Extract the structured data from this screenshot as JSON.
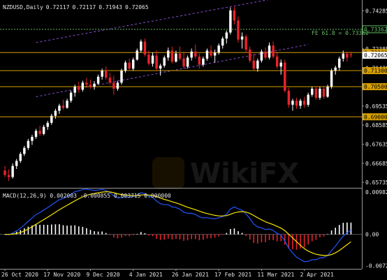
{
  "chart_data": [
    {
      "type": "candlestick",
      "title": "NZDUSD,Daily",
      "ohlc_readout": [
        "0.72117",
        "0.72117",
        "0.71943",
        "0.72065"
      ],
      "colors": {
        "bull": "#ffffff",
        "bear": "#e8232b",
        "background": "#000000",
        "level": "#d8a000",
        "fib": "#66c066",
        "channel": "#8a4fd6"
      },
      "y_axis": {
        "ticks": [
          0.74285,
          0.73335,
          0.72385,
          0.7143,
          0.7048,
          0.69535,
          0.68585,
          0.67635,
          0.66685,
          0.65735
        ],
        "ylim": [
          0.6553,
          0.7468
        ]
      },
      "x_axis": {
        "ticks": [
          "26 Oct 2020",
          "17 Nov 2020",
          "9 Dec 2020",
          "4 Jan 2021",
          "26 Jan 2021",
          "17 Feb 2021",
          "11 Mar 2021",
          "2 Apr 2021"
        ]
      },
      "candles": [
        [
          0.6632,
          0.6655,
          0.66,
          0.661
        ],
        [
          0.661,
          0.6638,
          0.658,
          0.66
        ],
        [
          0.66,
          0.6668,
          0.6592,
          0.6655
        ],
        [
          0.6655,
          0.669,
          0.664,
          0.668
        ],
        [
          0.668,
          0.6725,
          0.667,
          0.6715
        ],
        [
          0.6715,
          0.6755,
          0.6705,
          0.6745
        ],
        [
          0.6745,
          0.679,
          0.6735,
          0.678
        ],
        [
          0.678,
          0.681,
          0.676,
          0.68
        ],
        [
          0.68,
          0.684,
          0.679,
          0.683
        ],
        [
          0.683,
          0.6855,
          0.6805,
          0.6815
        ],
        [
          0.6815,
          0.686,
          0.6808,
          0.685
        ],
        [
          0.685,
          0.688,
          0.6835,
          0.687
        ],
        [
          0.687,
          0.6915,
          0.686,
          0.6905
        ],
        [
          0.6905,
          0.694,
          0.689,
          0.693
        ],
        [
          0.693,
          0.6965,
          0.6915,
          0.6955
        ],
        [
          0.6955,
          0.6985,
          0.6935,
          0.6945
        ],
        [
          0.6945,
          0.699,
          0.694,
          0.698
        ],
        [
          0.698,
          0.703,
          0.697,
          0.702
        ],
        [
          0.702,
          0.706,
          0.7,
          0.705
        ],
        [
          0.705,
          0.7075,
          0.702,
          0.7035
        ],
        [
          0.7035,
          0.708,
          0.7025,
          0.707
        ],
        [
          0.707,
          0.7095,
          0.705,
          0.706
        ],
        [
          0.706,
          0.7085,
          0.704,
          0.705
        ],
        [
          0.705,
          0.7078,
          0.7035,
          0.7065
        ],
        [
          0.7065,
          0.711,
          0.706,
          0.71
        ],
        [
          0.71,
          0.714,
          0.7085,
          0.713
        ],
        [
          0.713,
          0.715,
          0.7085,
          0.7095
        ],
        [
          0.7095,
          0.712,
          0.706,
          0.707
        ],
        [
          0.707,
          0.7105,
          0.701,
          0.704
        ],
        [
          0.704,
          0.708,
          0.703,
          0.707
        ],
        [
          0.707,
          0.714,
          0.706,
          0.713
        ],
        [
          0.713,
          0.718,
          0.712,
          0.717
        ],
        [
          0.717,
          0.719,
          0.713,
          0.714
        ],
        [
          0.714,
          0.7195,
          0.713,
          0.7185
        ],
        [
          0.7185,
          0.724,
          0.718,
          0.723
        ],
        [
          0.723,
          0.7285,
          0.722,
          0.7275
        ],
        [
          0.7275,
          0.729,
          0.72,
          0.721
        ],
        [
          0.721,
          0.723,
          0.7155,
          0.7165
        ],
        [
          0.7165,
          0.722,
          0.715,
          0.7205
        ],
        [
          0.7205,
          0.723,
          0.713,
          0.714
        ],
        [
          0.714,
          0.7165,
          0.7105,
          0.7155
        ],
        [
          0.7155,
          0.7205,
          0.7145,
          0.7195
        ],
        [
          0.7195,
          0.7245,
          0.718,
          0.723
        ],
        [
          0.723,
          0.725,
          0.7165,
          0.7175
        ],
        [
          0.7175,
          0.723,
          0.717,
          0.7215
        ],
        [
          0.7215,
          0.725,
          0.718,
          0.719
        ],
        [
          0.719,
          0.7225,
          0.714,
          0.715
        ],
        [
          0.715,
          0.7205,
          0.714,
          0.7195
        ],
        [
          0.7195,
          0.724,
          0.718,
          0.7225
        ],
        [
          0.7225,
          0.726,
          0.719,
          0.72
        ],
        [
          0.72,
          0.7215,
          0.714,
          0.716
        ],
        [
          0.716,
          0.72,
          0.715,
          0.719
        ],
        [
          0.719,
          0.724,
          0.718,
          0.723
        ],
        [
          0.723,
          0.7255,
          0.7195,
          0.7205
        ],
        [
          0.7205,
          0.7235,
          0.717,
          0.722
        ],
        [
          0.722,
          0.7265,
          0.721,
          0.7255
        ],
        [
          0.7255,
          0.73,
          0.724,
          0.729
        ],
        [
          0.729,
          0.733,
          0.7265,
          0.732
        ],
        [
          0.732,
          0.7445,
          0.731,
          0.743
        ],
        [
          0.743,
          0.7448,
          0.736,
          0.738
        ],
        [
          0.738,
          0.74,
          0.727,
          0.7285
        ],
        [
          0.7285,
          0.732,
          0.724,
          0.73
        ],
        [
          0.73,
          0.731,
          0.722,
          0.7235
        ],
        [
          0.7235,
          0.725,
          0.717,
          0.718
        ],
        [
          0.718,
          0.7215,
          0.713,
          0.714
        ],
        [
          0.714,
          0.719,
          0.7125,
          0.718
        ],
        [
          0.718,
          0.7235,
          0.717,
          0.7225
        ],
        [
          0.7225,
          0.7245,
          0.7185,
          0.7195
        ],
        [
          0.7195,
          0.727,
          0.7185,
          0.7255
        ],
        [
          0.7255,
          0.7275,
          0.719,
          0.72
        ],
        [
          0.72,
          0.7225,
          0.714,
          0.715
        ],
        [
          0.715,
          0.7185,
          0.711,
          0.717
        ],
        [
          0.717,
          0.7185,
          0.702,
          0.703
        ],
        [
          0.703,
          0.7045,
          0.6945,
          0.696
        ],
        [
          0.696,
          0.699,
          0.693,
          0.698
        ],
        [
          0.698,
          0.6995,
          0.694,
          0.6955
        ],
        [
          0.6955,
          0.699,
          0.694,
          0.698
        ],
        [
          0.698,
          0.7,
          0.6945,
          0.696
        ],
        [
          0.696,
          0.702,
          0.695,
          0.701
        ],
        [
          0.701,
          0.705,
          0.7,
          0.704
        ],
        [
          0.704,
          0.7055,
          0.6985,
          0.6995
        ],
        [
          0.6995,
          0.705,
          0.6985,
          0.704
        ],
        [
          0.704,
          0.7055,
          0.699,
          0.7
        ],
        [
          0.7,
          0.706,
          0.6995,
          0.705
        ],
        [
          0.705,
          0.714,
          0.704,
          0.713
        ],
        [
          0.713,
          0.7155,
          0.711,
          0.7145
        ],
        [
          0.7145,
          0.72,
          0.713,
          0.719
        ],
        [
          0.719,
          0.723,
          0.7175,
          0.7215
        ],
        [
          0.7215,
          0.7225,
          0.7175,
          0.7195
        ],
        [
          0.7212,
          0.7225,
          0.7194,
          0.7207
        ]
      ],
      "levels": [
        {
          "price": 0.722,
          "label": "0.72200",
          "label_color": "#d8a000",
          "label_text_color": "#000000"
        },
        {
          "price": 0.713,
          "label": "0.71300",
          "label_color": "#d8a000",
          "label_text_color": "#000000"
        },
        {
          "price": 0.705,
          "label": "0.70500",
          "label_color": "#d8a000",
          "label_text_color": "#000000"
        },
        {
          "price": 0.69,
          "label": "0.69000",
          "label_color": "#d8a000",
          "label_text_color": "#000000"
        }
      ],
      "fib": {
        "price": 0.7336,
        "label": "FE 61.8 = 0.73362"
      },
      "channel": {
        "upper": [
          [
            8,
            0.727
          ],
          [
            78,
            0.752
          ]
        ],
        "lower": [
          [
            8,
            0.7
          ],
          [
            78,
            0.726
          ]
        ]
      },
      "current_price_label": "0.72065"
    },
    {
      "type": "macd",
      "title": "MACD(12,26,9) 0.002003 -0.000855 0.003715 0.000000",
      "params": [
        12,
        26,
        9
      ],
      "readout": [
        "0.002003",
        "-0.000855",
        "0.003715",
        "0.000000"
      ],
      "y_axis": {
        "ticks": [
          "0.009825",
          "0.00",
          "-0.007285"
        ],
        "ylim": [
          -0.008,
          0.0103
        ]
      },
      "colors": {
        "hist_pos": "#ffffff",
        "hist_neg": "#e8232b",
        "line1": "#f5e400",
        "line2": "#2255ff"
      }
    }
  ]
}
